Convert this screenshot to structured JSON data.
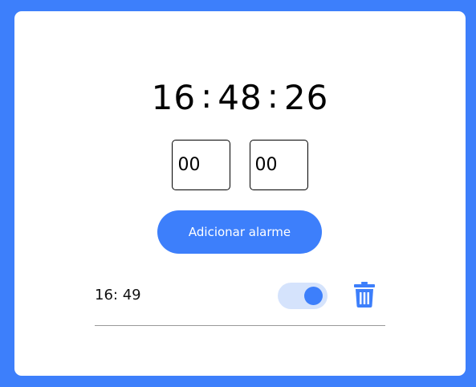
{
  "clock": {
    "hours": "16",
    "minutes": "48",
    "seconds": "26",
    "separator": ":"
  },
  "inputs": {
    "hour_value": "00",
    "minute_value": "00"
  },
  "add_button": {
    "label": "Adicionar alarme"
  },
  "alarms": [
    {
      "time": "16: 49",
      "enabled": true
    }
  ],
  "icons": {
    "delete": "trash-icon"
  },
  "colors": {
    "accent": "#3d7ffb",
    "toggle_track": "#d5e3fc",
    "card": "#ffffff"
  }
}
